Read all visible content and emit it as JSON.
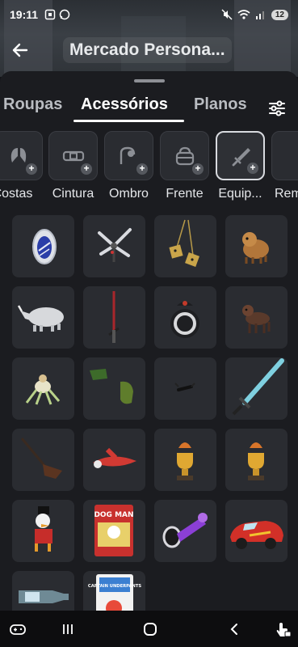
{
  "status_bar": {
    "time": "19:11",
    "battery": "12",
    "left_icons": [
      "screenshot-icon",
      "whatsapp-icon"
    ],
    "right_icons": [
      "mute-icon",
      "wifi-icon",
      "signal-icon",
      "battery-icon"
    ]
  },
  "header": {
    "title": "Mercado Persona..."
  },
  "tabs": [
    {
      "label": "Roupas",
      "active": false
    },
    {
      "label": "Acessórios",
      "active": true
    },
    {
      "label": "Planos",
      "active": false
    }
  ],
  "categories": [
    {
      "label": "Costas",
      "icon": "wings-icon",
      "selected": false
    },
    {
      "label": "Cintura",
      "icon": "belt-icon",
      "selected": false
    },
    {
      "label": "Ombro",
      "icon": "shoulder-pet-icon",
      "selected": false
    },
    {
      "label": "Frente",
      "icon": "front-bag-icon",
      "selected": false
    },
    {
      "label": "Equip...",
      "icon": "sword-icon",
      "selected": true
    },
    {
      "label": "Rem",
      "icon": "",
      "selected": false
    }
  ],
  "items": [
    {
      "name": "egg-mirror-item"
    },
    {
      "name": "dragonfly-item"
    },
    {
      "name": "hanging-dice-item"
    },
    {
      "name": "sheep-dog-item"
    },
    {
      "name": "rhino-item"
    },
    {
      "name": "red-lightsaber-item"
    },
    {
      "name": "bb-droid-item"
    },
    {
      "name": "brown-dog-item"
    },
    {
      "name": "mech-spider-item"
    },
    {
      "name": "green-gloves-item"
    },
    {
      "name": "black-bug-item"
    },
    {
      "name": "blue-sword-item"
    },
    {
      "name": "guitar-item"
    },
    {
      "name": "red-plane-item"
    },
    {
      "name": "gold-trophy-item"
    },
    {
      "name": "gold-trophy-item-2"
    },
    {
      "name": "duck-figure-item"
    },
    {
      "name": "dog-man-book-item"
    },
    {
      "name": "purple-horn-item"
    },
    {
      "name": "red-race-car-item"
    },
    {
      "name": "bottle-item"
    },
    {
      "name": "captain-underpants-book-item"
    }
  ],
  "book_labels": {
    "dogman_top": "DOG MAN",
    "captain": "CAPTAIN UNDERPANTS"
  },
  "nav_bar": {
    "buttons": [
      "game-controller-icon",
      "recents-icon",
      "home-icon",
      "back-nav-icon",
      "touch-lock-icon"
    ]
  },
  "colors": {
    "sheet_bg": "#1b1c20",
    "tile_bg": "#2a2c31",
    "accent_white": "#ffffff"
  }
}
